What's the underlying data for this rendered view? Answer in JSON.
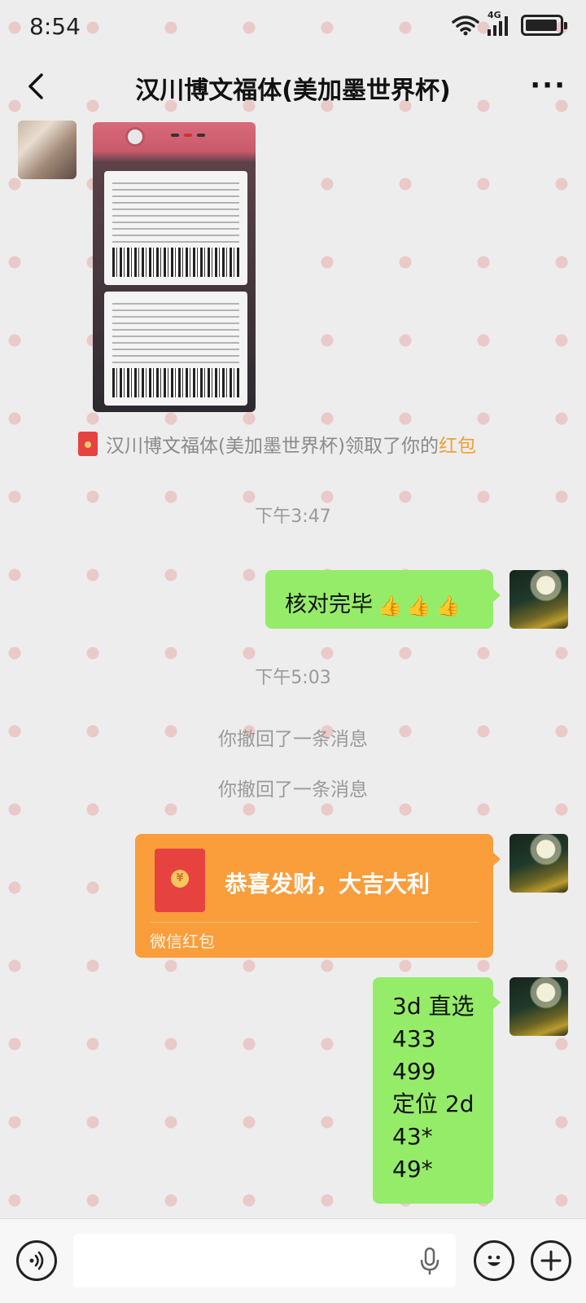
{
  "status_bar": {
    "time": "8:54",
    "network": "4G"
  },
  "header": {
    "title": "汉川博文福体(美加墨世界杯)",
    "more": "···"
  },
  "messages": {
    "notice_prefix": "汉川博文福体(美加墨世界杯)领取了你的",
    "notice_highlight": "红包",
    "time_1": "下午3:47",
    "bubble_1": "核对完毕",
    "bubble_1_emojis": [
      "👍",
      "👍",
      "👍"
    ],
    "time_2": "下午5:03",
    "recalled_1": "你撤回了一条消息",
    "recalled_2": "你撤回了一条消息",
    "red_packet": {
      "title": "恭喜发财，大吉大利",
      "label": "微信红包",
      "coin": "¥"
    },
    "bubble_2_lines": [
      "3d 直选",
      "433",
      "499",
      "定位 2d",
      "43*",
      "49*"
    ]
  },
  "colors": {
    "bubble": "#95ec69",
    "red_packet": "#fa9d3b",
    "background": "#ededed",
    "highlight": "#f0a030"
  },
  "icons": [
    "wifi-icon",
    "signal-icon",
    "battery-icon",
    "back-icon",
    "more-icon",
    "voice-icon",
    "mic-icon",
    "emoji-icon",
    "plus-icon",
    "red-packet-icon"
  ]
}
